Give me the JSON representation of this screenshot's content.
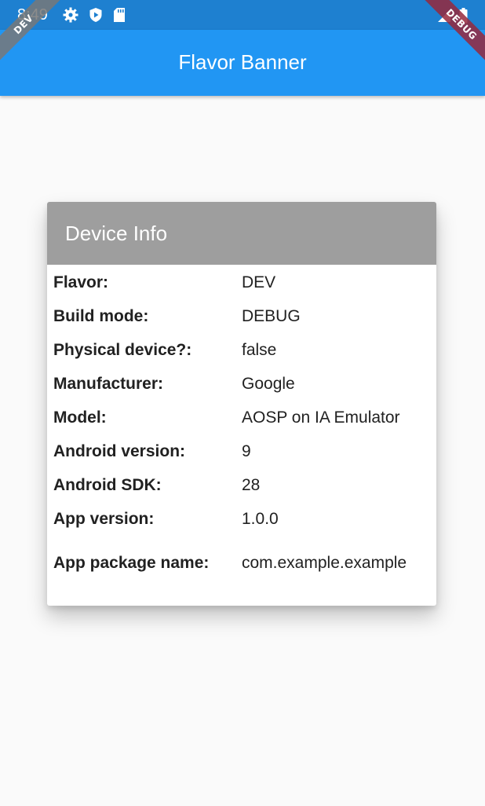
{
  "status_bar": {
    "time": "8:49",
    "icons_left": [
      "gear-icon",
      "play-shield-icon",
      "sd-card-icon"
    ],
    "icons_right": [
      "wifi-icon",
      "battery-icon"
    ]
  },
  "ribbons": {
    "left": "DEV",
    "right": "DEBUG"
  },
  "app_bar": {
    "title": "Flavor Banner",
    "color": "#2196f3"
  },
  "card": {
    "title": "Device Info",
    "header_color": "#9e9e9e",
    "rows": [
      {
        "label": "Flavor:",
        "value": "DEV"
      },
      {
        "label": "Build mode:",
        "value": "DEBUG"
      },
      {
        "label": "Physical device?:",
        "value": "false"
      },
      {
        "label": "Manufacturer:",
        "value": "Google"
      },
      {
        "label": "Model:",
        "value": "AOSP on IA Emulator"
      },
      {
        "label": "Android version:",
        "value": "9"
      },
      {
        "label": "Android SDK:",
        "value": "28"
      },
      {
        "label": "App version:",
        "value": "1.0.0"
      },
      {
        "label": "App package name:",
        "value": "com.example.example"
      }
    ]
  }
}
